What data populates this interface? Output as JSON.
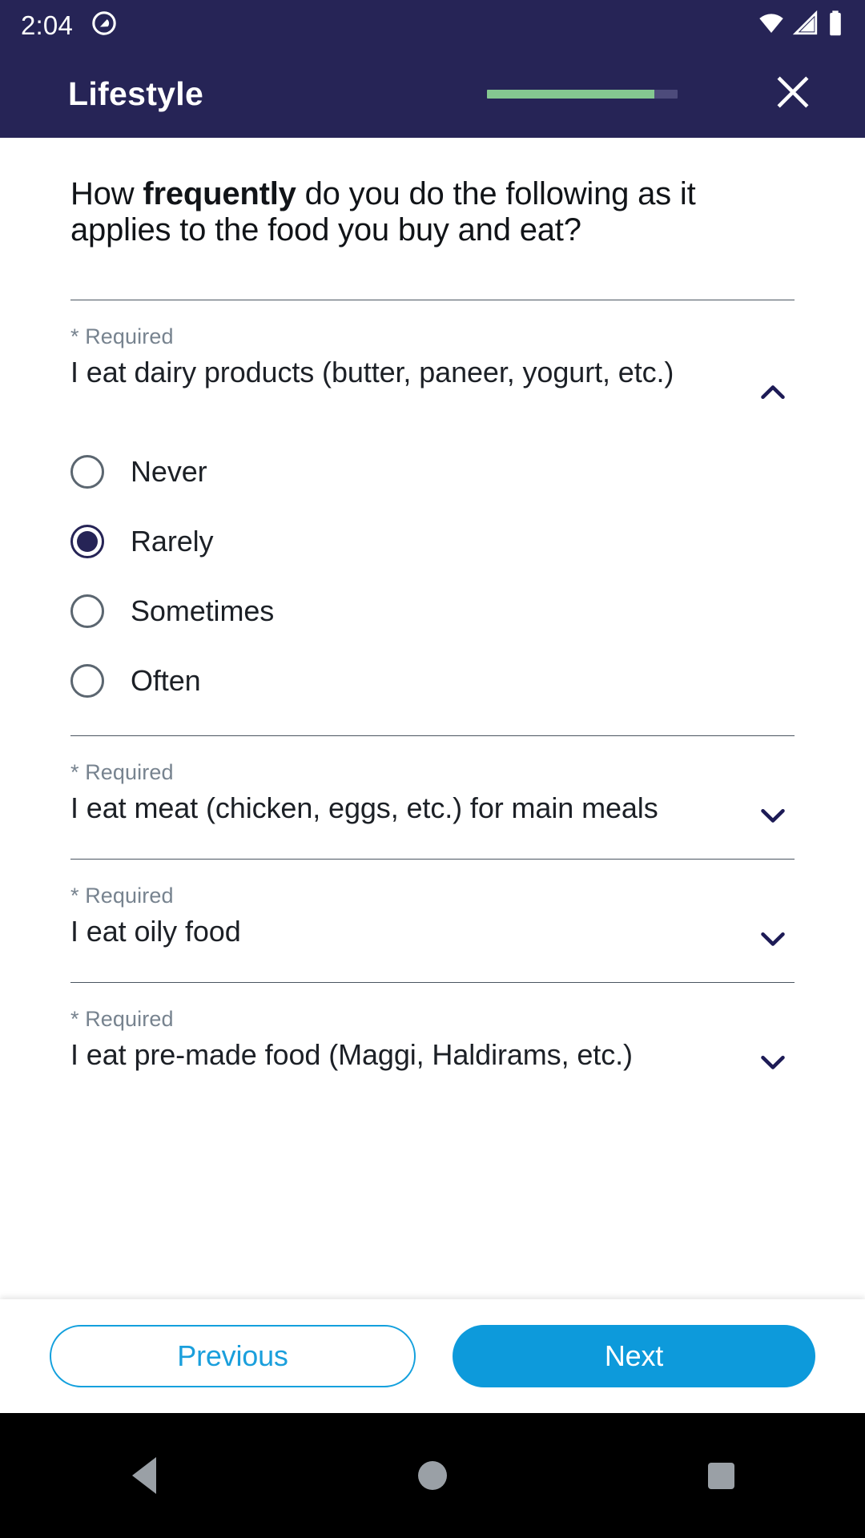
{
  "status_bar": {
    "time": "2:04",
    "icons": [
      "android-q-icon",
      "wifi-icon",
      "cell-signal-icon",
      "battery-icon"
    ]
  },
  "app_bar": {
    "title": "Lifestyle",
    "progress_percent": 88,
    "close_label": "×",
    "bar_color": "#84c791",
    "track_color": "#4d4b7b",
    "background": "#262456"
  },
  "survey": {
    "header_before": "How ",
    "header_bold": "frequently",
    "header_after": " do you do the following as it applies to the food you buy and eat?",
    "required_label": "* Required",
    "questions": [
      {
        "required": "* Required",
        "text": "I eat dairy products (butter, paneer, yogurt, etc.)",
        "expanded": true,
        "chevron": "chevron-up-icon",
        "options": [
          {
            "label": "Never",
            "selected": false
          },
          {
            "label": "Rarely",
            "selected": true
          },
          {
            "label": "Sometimes",
            "selected": false
          },
          {
            "label": "Often",
            "selected": false
          }
        ]
      },
      {
        "required": "* Required",
        "text": "I eat meat (chicken, eggs, etc.) for main meals",
        "expanded": false,
        "chevron": "chevron-down-icon",
        "options": []
      },
      {
        "required": "* Required",
        "text": "I eat oily food",
        "expanded": false,
        "chevron": "chevron-down-icon",
        "options": []
      },
      {
        "required": "* Required",
        "text": "I eat pre-made food (Maggi, Haldirams, etc.)",
        "expanded": false,
        "chevron": "chevron-down-icon",
        "options": []
      }
    ]
  },
  "footer": {
    "previous_label": "Previous",
    "next_label": "Next",
    "accent_color": "#0d9adb"
  },
  "nav_bar": {
    "back": "back-triangle-icon",
    "home": "home-circle-icon",
    "recents": "recents-square-icon"
  }
}
